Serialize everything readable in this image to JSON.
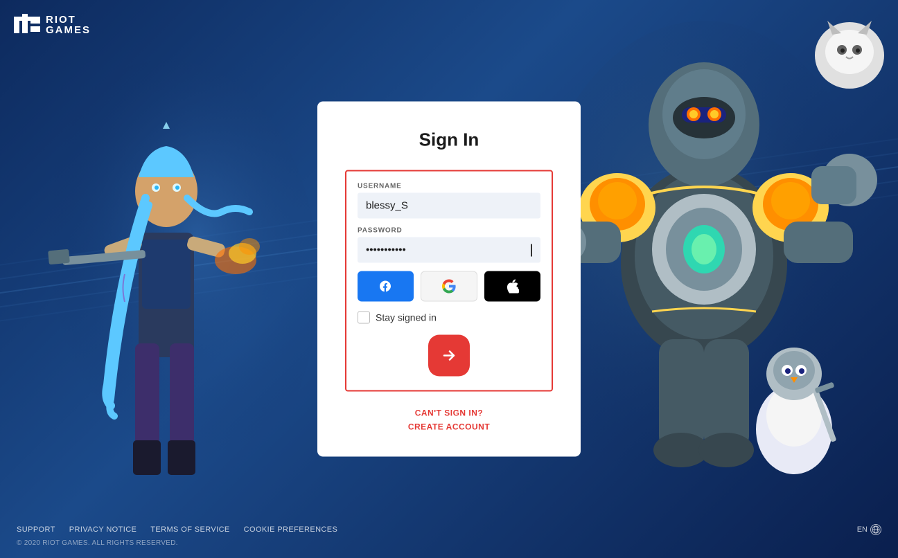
{
  "logo": {
    "text_line1": "RIOT",
    "text_line2": "GAMES"
  },
  "card": {
    "title": "Sign In",
    "username_label": "USERNAME",
    "username_value": "blessy_S",
    "password_label": "PASSWORD",
    "password_value": "••••••••••••",
    "stay_signed_label": "Stay signed in",
    "submit_label": "→",
    "cant_sign_in": "CAN'T SIGN IN?",
    "create_account": "CREATE ACCOUNT"
  },
  "social": {
    "facebook_label": "f",
    "google_label": "G",
    "apple_label": "🍎"
  },
  "footer": {
    "support": "SUPPORT",
    "privacy": "PRIVACY NOTICE",
    "terms": "TERMS OF SERVICE",
    "cookie": "COOKIE PREFERENCES",
    "lang": "EN",
    "copyright": "© 2020 RIOT GAMES. ALL RIGHTS RESERVED."
  }
}
